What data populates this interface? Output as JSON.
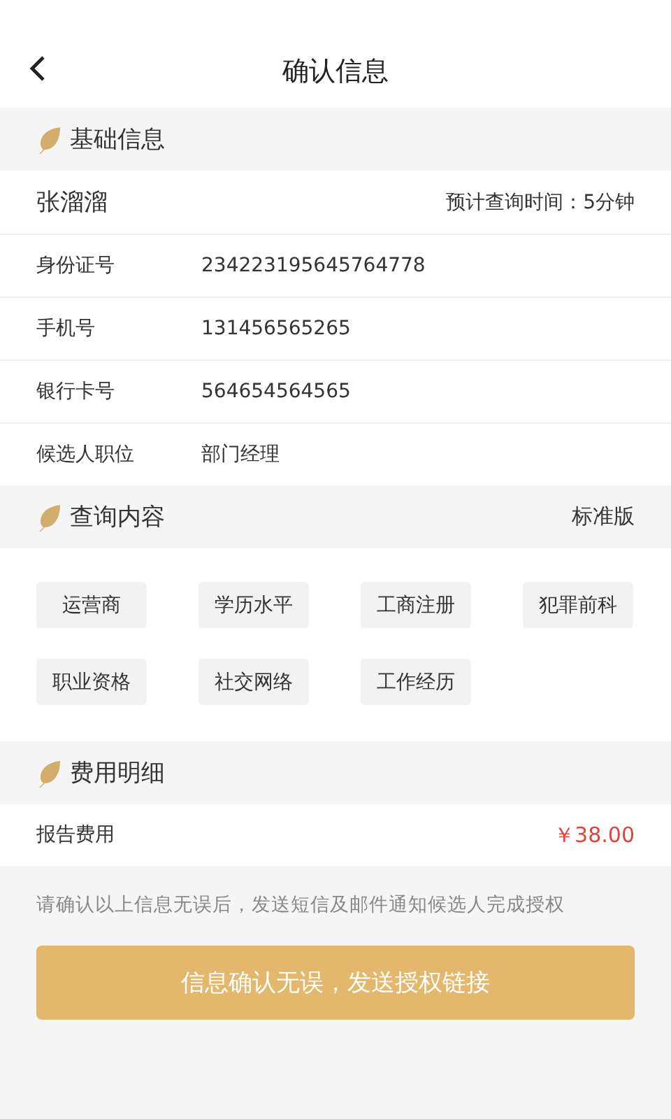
{
  "header": {
    "title": "确认信息"
  },
  "basic": {
    "title": "基础信息",
    "name": "张溜溜",
    "estimate": "预计查询时间：5分钟",
    "fields": [
      {
        "label": "身份证号",
        "value": "234223195645764778"
      },
      {
        "label": "手机号",
        "value": "131456565265"
      },
      {
        "label": "银行卡号",
        "value": "564654564565"
      },
      {
        "label": "候选人职位",
        "value": "部门经理"
      }
    ]
  },
  "query": {
    "title": "查询内容",
    "version": "标准版",
    "items": [
      "运营商",
      "学历水平",
      "工商注册",
      "犯罪前科",
      "职业资格",
      "社交网络",
      "工作经历"
    ]
  },
  "fees": {
    "title": "费用明细",
    "items": [
      {
        "label": "报告费用",
        "amount": "￥38.00"
      }
    ]
  },
  "note": "请确认以上信息无误后，发送短信及邮件通知候选人完成授权",
  "confirm_button": "信息确认无误，发送授权链接"
}
